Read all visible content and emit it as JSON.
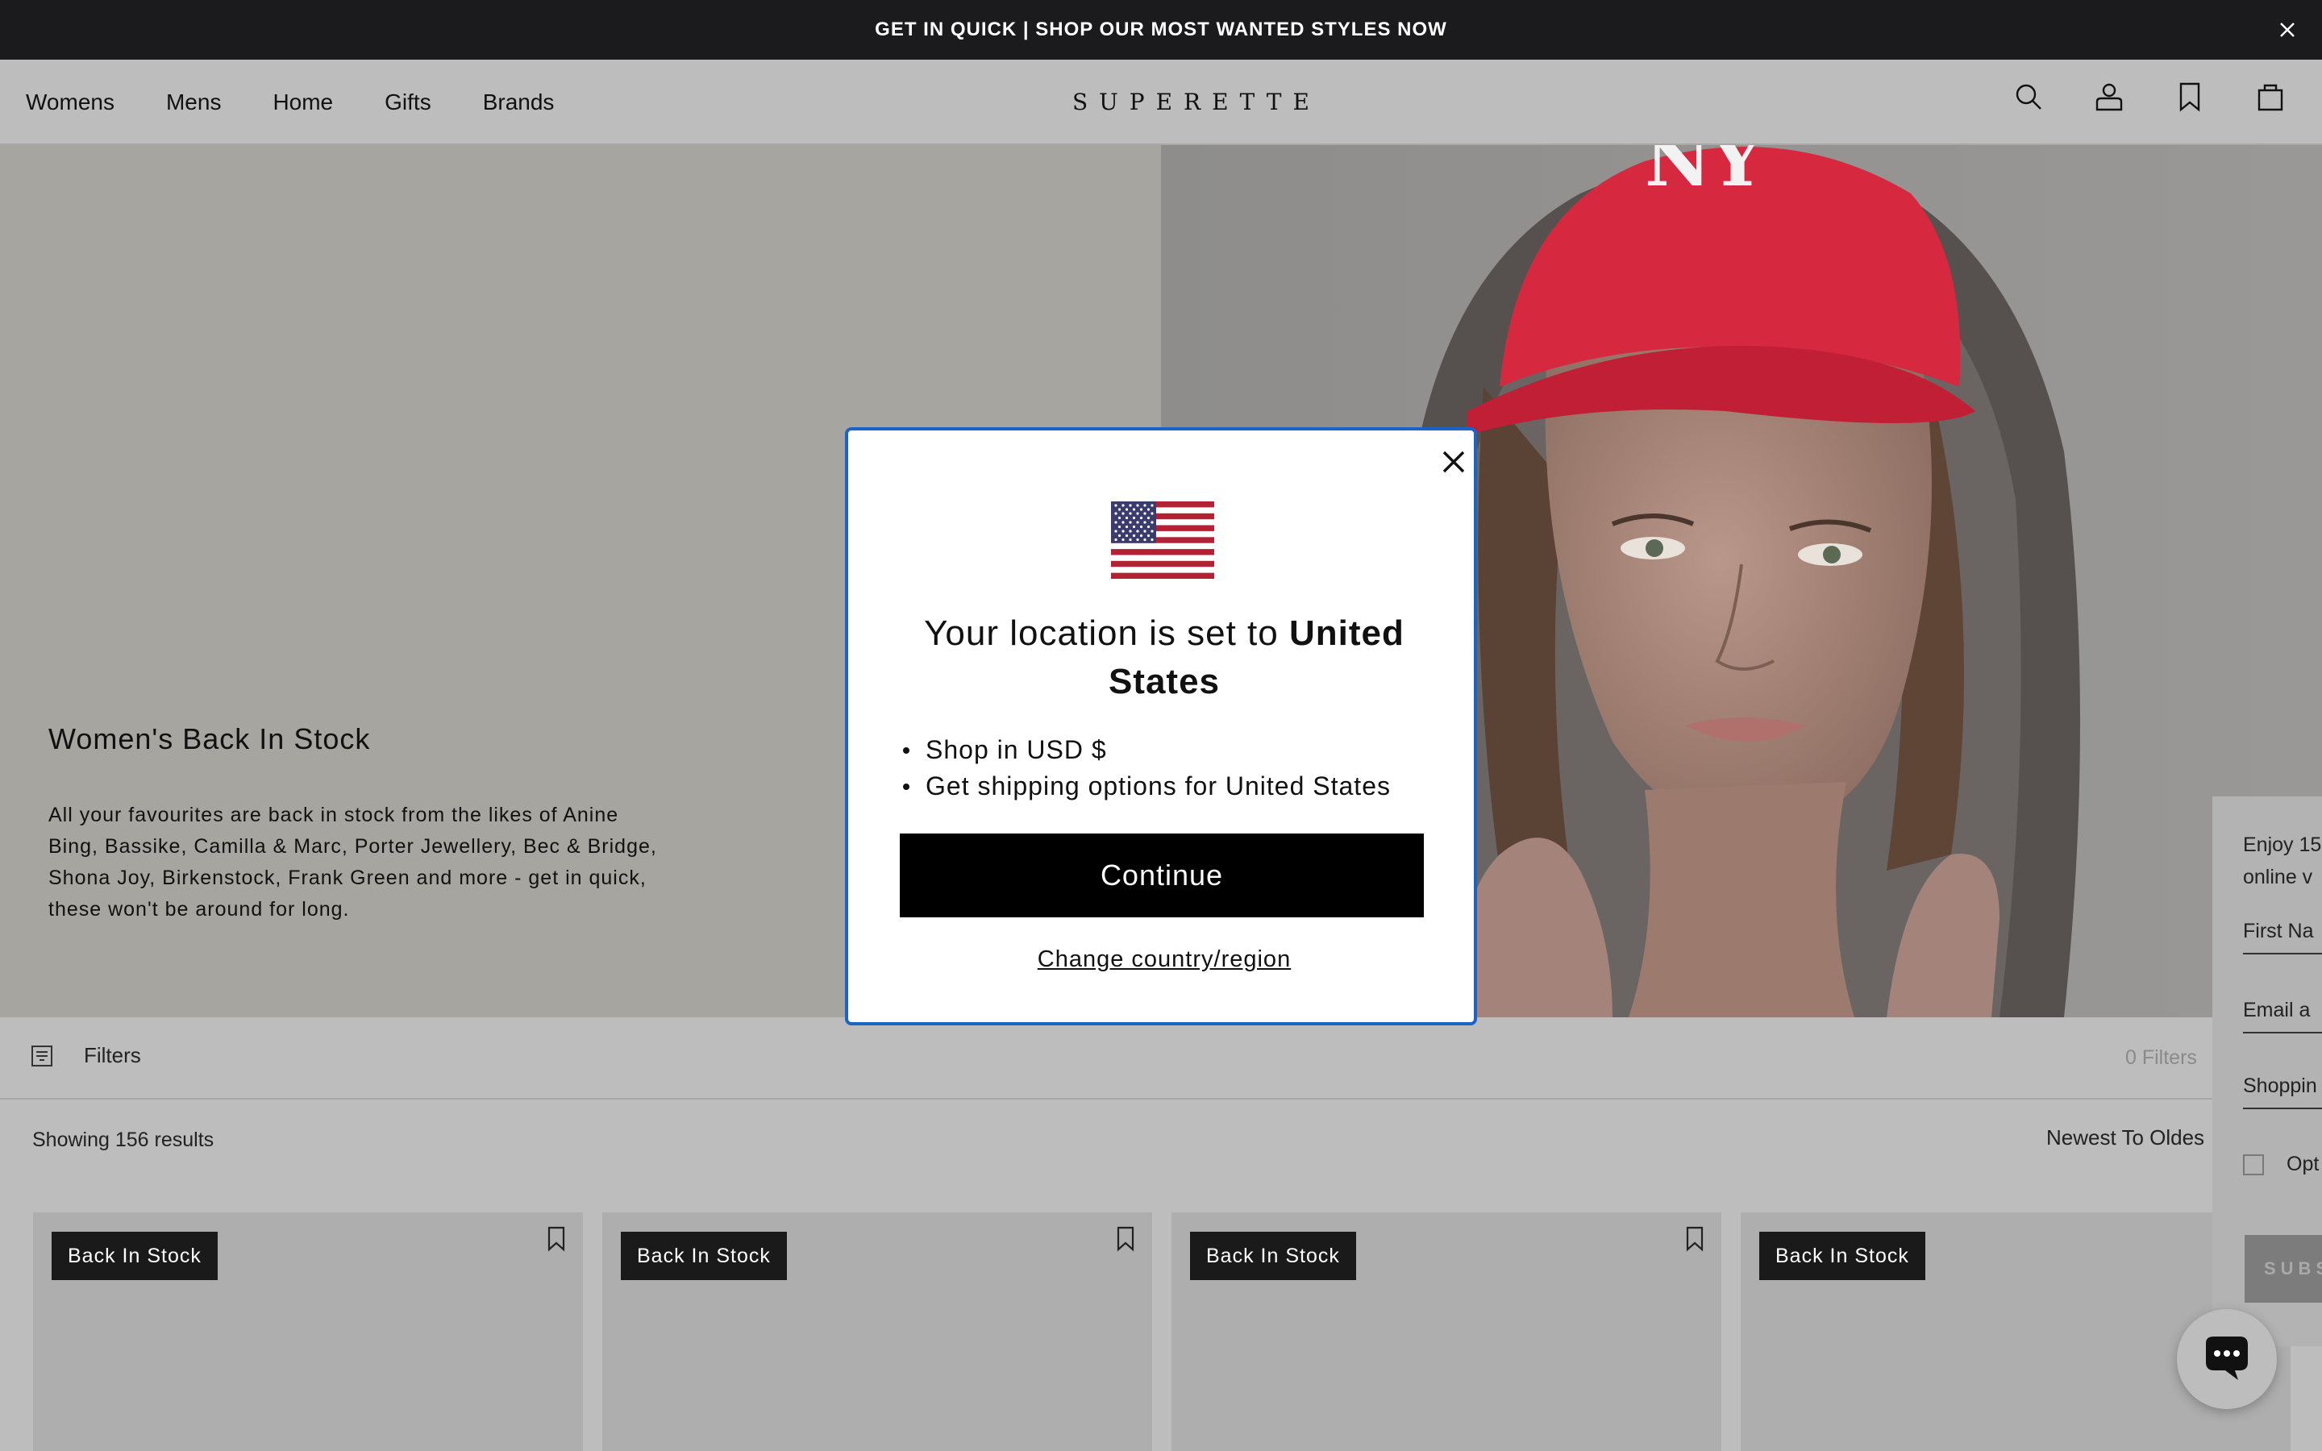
{
  "announcement": {
    "text": "GET IN QUICK | SHOP OUR MOST WANTED STYLES NOW"
  },
  "nav": {
    "items": [
      "Womens",
      "Mens",
      "Home",
      "Gifts",
      "Brands"
    ]
  },
  "brand": {
    "logo": "SUPERETTE"
  },
  "hero": {
    "title": "Women's Back In Stock",
    "body": "All your favourites are back in stock from the likes of Anine Bing, Bassike, Camilla & Marc, Porter Jewellery, Bec & Bridge, Shona Joy, Birkenstock, Frank Green and more - get in quick, these won't be around for long.",
    "cap_logo": "NY"
  },
  "filters": {
    "label": "Filters",
    "count_label": "0 Filters"
  },
  "results": {
    "text": "Showing 156 results"
  },
  "sort": {
    "label": "Newest To Oldes"
  },
  "products": [
    {
      "badge": "Back In Stock"
    },
    {
      "badge": "Back In Stock"
    },
    {
      "badge": "Back In Stock"
    },
    {
      "badge": "Back In Stock"
    }
  ],
  "newsletter": {
    "text_line1": "Enjoy 15",
    "text_line2": "online v",
    "first_name": "First Na",
    "email": "Email a",
    "shopping": "Shoppin",
    "opt": "Opt",
    "subscribe": "SUBS"
  },
  "modal": {
    "heading_prefix": "Your location is set to ",
    "heading_country": "United States",
    "bullets": [
      "Shop in USD $",
      "Get shipping options for United States"
    ],
    "continue_label": "Continue",
    "change_label": "Change country/region"
  },
  "colors": {
    "announcement_bg": "#1b1b1d",
    "overlay_bg": "#bdbdbd",
    "modal_focus_border": "#1a64c8",
    "button_bg": "#000000",
    "badge_bg": "#1a1a1a",
    "cap_red": "#d6283f"
  }
}
